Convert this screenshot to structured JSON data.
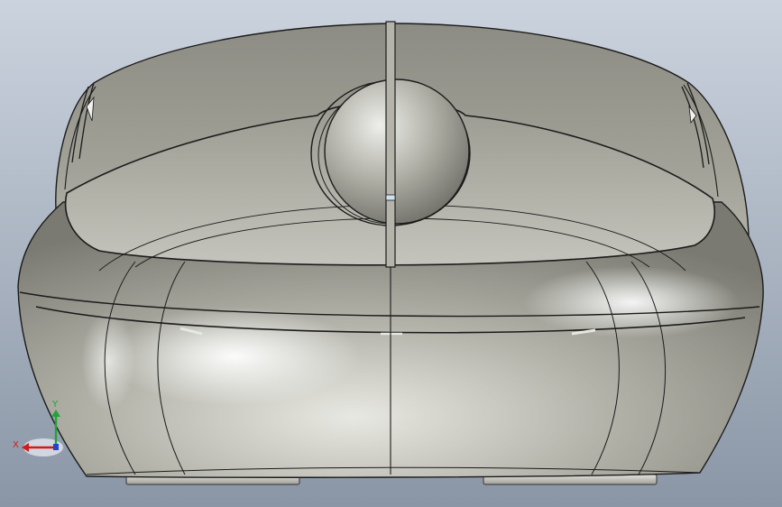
{
  "viewport": {
    "background_top": "#c5ceda",
    "background_bottom": "#8e9aa9",
    "model_body_color": "#a6a69c",
    "model_highlight_color": "#f2f2ec",
    "model_edge_color": "#1b1b1b",
    "foot_color": "#c9c9c2"
  },
  "model": {
    "description_icon": "3d-mouse-model-icon"
  },
  "triad": {
    "x_label": "X",
    "y_label": "Y",
    "x_color": "#d21a1a",
    "y_color": "#1fa33a",
    "z_color": "#2146d0"
  }
}
